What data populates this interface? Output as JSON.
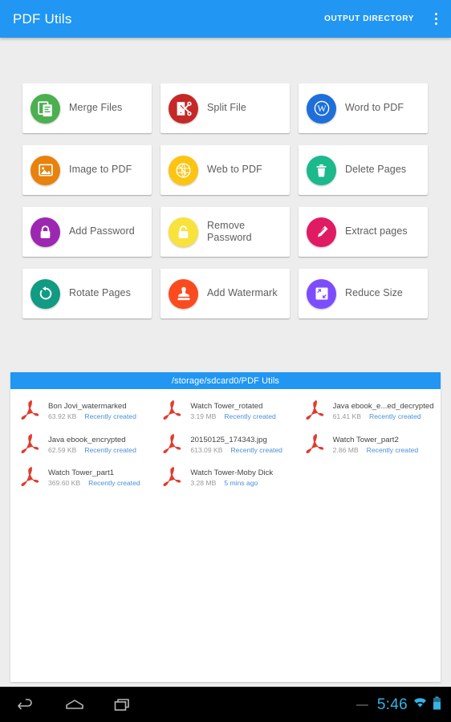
{
  "appbar": {
    "title": "PDF Utils",
    "action_label": "OUTPUT DIRECTORY",
    "overflow_icon": "more-vert-icon",
    "background": "#2196f3"
  },
  "tools": [
    {
      "label": "Merge Files",
      "icon": "merge-files-icon",
      "color": "#4caf50"
    },
    {
      "label": "Split File",
      "icon": "split-file-icon",
      "color": "#c62828"
    },
    {
      "label": "Word to PDF",
      "icon": "word-to-pdf-icon",
      "color": "#1e6fd9"
    },
    {
      "label": "Image to PDF",
      "icon": "image-to-pdf-icon",
      "color": "#e8820c"
    },
    {
      "label": "Web to PDF",
      "icon": "web-to-pdf-icon",
      "color": "#fdc412"
    },
    {
      "label": "Delete Pages",
      "icon": "delete-pages-icon",
      "color": "#1bb98c"
    },
    {
      "label": "Add Password",
      "icon": "add-password-icon",
      "color": "#9c27b0"
    },
    {
      "label": "Remove Password",
      "icon": "remove-password-icon",
      "color": "#f9e23c"
    },
    {
      "label": "Extract pages",
      "icon": "extract-pages-icon",
      "color": "#e01b63"
    },
    {
      "label": "Rotate Pages",
      "icon": "rotate-pages-icon",
      "color": "#109b82"
    },
    {
      "label": "Add Watermark",
      "icon": "add-watermark-icon",
      "color": "#fb4b1e"
    },
    {
      "label": "Reduce Size",
      "icon": "reduce-size-icon",
      "color": "#7c4dff"
    }
  ],
  "filepanel": {
    "path": "/storage/sdcard0/PDF Utils",
    "files": [
      {
        "name": "Bon Jovi_watermarked",
        "size": "63.92 KB",
        "time": "Recently created"
      },
      {
        "name": "Watch Tower_rotated",
        "size": "3.19 MB",
        "time": "Recently created"
      },
      {
        "name": "Java ebook_e...ed_decrypted",
        "size": "61.41 KB",
        "time": "Recently created"
      },
      {
        "name": "Java ebook_encrypted",
        "size": "62.59 KB",
        "time": "Recently created"
      },
      {
        "name": "20150125_174343.jpg",
        "size": "613.09 KB",
        "time": "Recently created"
      },
      {
        "name": "Watch Tower_part2",
        "size": "2.86 MB",
        "time": "Recently created"
      },
      {
        "name": "Watch Tower_part1",
        "size": "369.60 KB",
        "time": "Recently created"
      },
      {
        "name": "Watch Tower-Moby Dick",
        "size": "3.28 MB",
        "time": "5 mins ago"
      }
    ]
  },
  "navbar": {
    "back_icon": "back-arrow-icon",
    "home_icon": "home-icon",
    "recents_icon": "recent-apps-icon",
    "dash": "—",
    "clock": "5:46",
    "wifi_icon": "wifi-icon",
    "battery_icon": "battery-icon",
    "accent": "#33b5e5"
  }
}
